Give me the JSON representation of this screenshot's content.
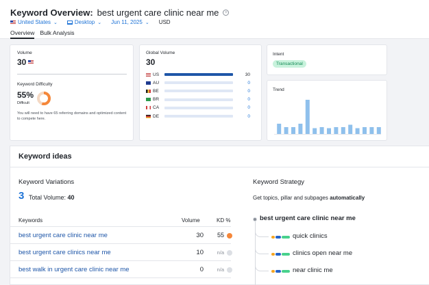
{
  "header": {
    "title_label": "Keyword Overview:",
    "keyword": "best urgent care clinic near me",
    "filters": {
      "country": "United States",
      "device": "Desktop",
      "date": "Jun 11, 2025",
      "currency": "USD"
    },
    "tabs": [
      "Overview",
      "Bulk Analysis"
    ]
  },
  "volume_card": {
    "volume_label": "Volume",
    "volume_value": "30",
    "kd_label": "Keyword Difficulty",
    "kd_value": "55%",
    "kd_level": "Difficult",
    "kd_fraction": 0.55,
    "kd_note": "You will need to have 65 referring domains and optimized content to compete here."
  },
  "global_card": {
    "label": "Global Volume",
    "value": "30",
    "countries": [
      {
        "code": "US",
        "value": "30",
        "share": 1.0
      },
      {
        "code": "AU",
        "value": "0",
        "share": 0
      },
      {
        "code": "BE",
        "value": "0",
        "share": 0
      },
      {
        "code": "BR",
        "value": "0",
        "share": 0
      },
      {
        "code": "CA",
        "value": "0",
        "share": 0
      },
      {
        "code": "DE",
        "value": "0",
        "share": 0
      }
    ]
  },
  "intent_card": {
    "label": "Intent",
    "badge": "Transactional"
  },
  "trend_card": {
    "label": "Trend",
    "values": [
      0.3,
      0.2,
      0.2,
      0.3,
      1.0,
      0.17,
      0.2,
      0.17,
      0.2,
      0.2,
      0.27,
      0.17,
      0.2,
      0.2,
      0.2
    ]
  },
  "ideas": {
    "title": "Keyword ideas",
    "variations": {
      "title": "Keyword Variations",
      "count": "3",
      "total_label": "Total Volume:",
      "total_value": "40",
      "col_keywords": "Keywords",
      "col_volume": "Volume",
      "col_kd": "KD %",
      "rows": [
        {
          "keyword": "best urgent care clinic near me",
          "volume": "30",
          "kd": "55",
          "kd_color": "#f5873a"
        },
        {
          "keyword": "best urgent care clinics near me",
          "volume": "10",
          "kd": "n/a",
          "kd_color": "#dcdfe4"
        },
        {
          "keyword": "best walk in urgent care clinic near me",
          "volume": "0",
          "kd": "n/a",
          "kd_color": "#dcdfe4"
        }
      ]
    },
    "strategy": {
      "title": "Keyword Strategy",
      "desc_prefix": "Get topics, pillar and subpages",
      "desc_bold": "automatically",
      "root": "best urgent care clinic near me",
      "children": [
        "quick clinics",
        "clinics open near me",
        "near clinic me"
      ]
    }
  }
}
